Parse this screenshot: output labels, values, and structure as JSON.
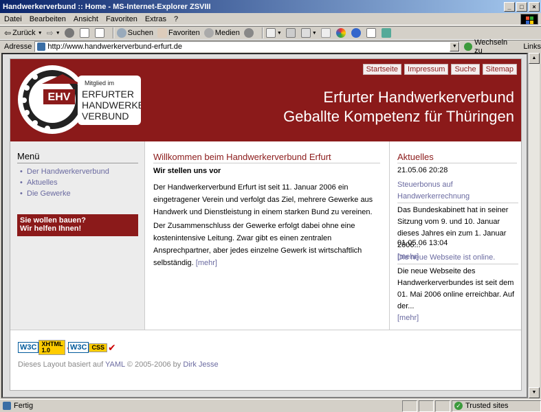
{
  "window": {
    "title": "Handwerkerverbund :: Home - MS-Internet-Explorer ZSVIII"
  },
  "menubar": {
    "items": [
      "Datei",
      "Bearbeiten",
      "Ansicht",
      "Favoriten",
      "Extras",
      "?"
    ]
  },
  "toolbar": {
    "back_label": "Zurück",
    "search_label": "Suchen",
    "favorites_label": "Favoriten",
    "media_label": "Medien"
  },
  "addressbar": {
    "label": "Adresse",
    "url": "http://www.handwerkerverbund-erfurt.de",
    "go_label": "Wechseln zu",
    "links_label": "Links"
  },
  "site": {
    "logo": {
      "badge": "EHV",
      "text1": "Mitglied im",
      "text2": "ERFURTER",
      "text3": "HANDWERKER",
      "text4": "VERBUND"
    },
    "topnav": [
      "Startseite",
      "Impressum",
      "Suche",
      "Sitemap"
    ],
    "slogan_line1": "Erfurter Handwerkerverbund",
    "slogan_line2": "Geballte Kompetenz für Thüringen",
    "menu": {
      "title": "Menü",
      "items": [
        "Der Handwerkerverbund",
        "Aktuelles",
        "Die Gewerke"
      ],
      "promo_line1": "Sie wollen bauen?",
      "promo_line2": "Wir helfen Ihnen!"
    },
    "main": {
      "title": "Willkommen beim Handwerkerverbund Erfurt",
      "subtitle": "Wir stellen uns vor",
      "p1": "Der Handwerkerverbund Erfurt ist seit 11. Januar 2006 ein eingetragener Verein und verfolgt das Ziel, mehrere Gewerke aus Handwerk und Dienstleistung in einem starken Bund zu vereinen.",
      "p2": "Der Zusammenschluss der Gewerke erfolgt dabei ohne eine kostenintensive Leitung. Zwar gibt es einen zentralen Ansprechpartner, aber jedes einzelne Gewerk ist wirtschaftlich selbständig.",
      "more": "[mehr]"
    },
    "news": {
      "title": "Aktuelles",
      "items": [
        {
          "date": "21.05.06 20:28",
          "headline": "Steuerbonus auf Handwerkerrechnung",
          "text": "Das Bundeskabinett hat in seiner Sitzung vom 9. und 10. Januar dieses Jahres ein zum 1. Januar 2006...",
          "more": "[mehr]"
        },
        {
          "date": "01.05.06 13:04",
          "headline": "Die neue Webseite ist online.",
          "text": "Die neue Webseite des Handwerkerverbundes ist seit dem 01. Mai 2006 online erreichbar. Auf der...",
          "more": "[mehr]"
        }
      ]
    },
    "footer": {
      "badge1_w3c": "W3C",
      "badge1_a": "XHTML",
      "badge1_b": "1.0",
      "badge2_w3c": "W3C",
      "badge2_a": "CSS",
      "text_prefix": "Dieses Layout basiert auf",
      "yaml": "YAML",
      "text_mid": "© 2005-2006 by",
      "author": "Dirk Jesse"
    }
  },
  "statusbar": {
    "text": "Fertig",
    "zone": "Trusted sites"
  },
  "colors": {
    "brand": "#8b1a1a",
    "link": "#6a6aa0"
  }
}
